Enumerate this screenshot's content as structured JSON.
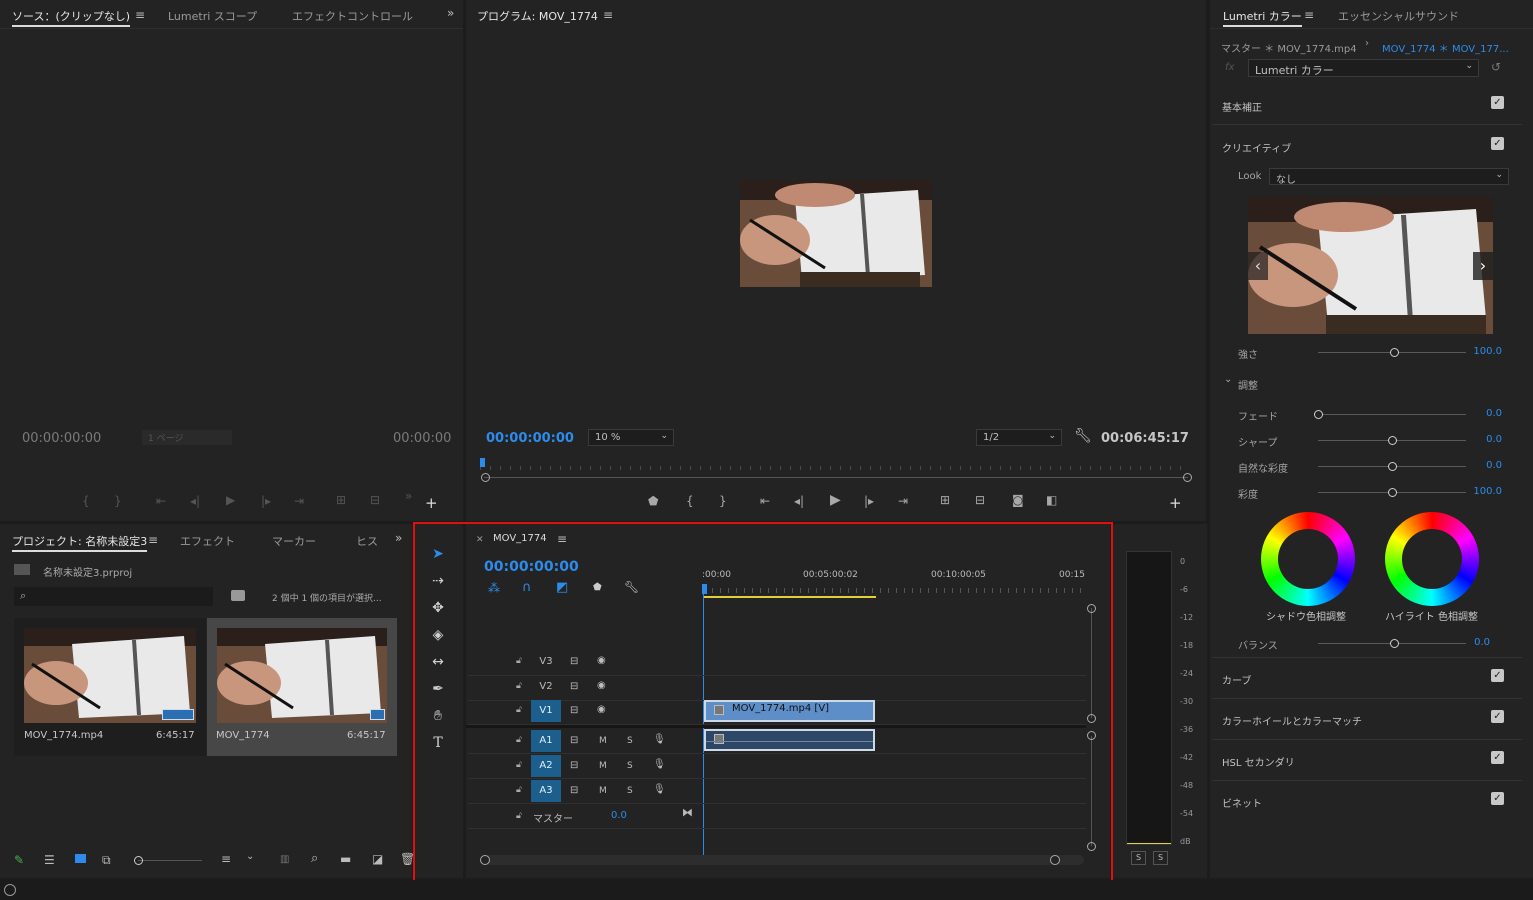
{
  "source_panel": {
    "tabs": [
      "ソース：(クリップなし)",
      "Lumetri スコープ",
      "エフェクトコントロール"
    ],
    "timecode_left": "00:00:00:00",
    "timecode_right": "00:00:00",
    "page_field": "1 ページ"
  },
  "program_panel": {
    "title": "プログラム: MOV_1774",
    "timecode": "00:00:00:00",
    "zoom": "10 %",
    "resolution": "1/2",
    "duration": "00:06:45:17"
  },
  "lumetri_panel": {
    "tabs": [
      "Lumetri カラー",
      "エッセンシャルサウンド"
    ],
    "master_label": "マスター ＊ MOV_1774.mp4",
    "clip_label": "MOV_1774 ＊ MOV_177...",
    "effect_dropdown": "Lumetri カラー",
    "sections": {
      "basic": "基本補正",
      "creative": "クリエイティブ",
      "curves": "カーブ",
      "color_wheels": "カラーホイールとカラーマッチ",
      "hsl": "HSL セカンダリ",
      "vignette": "ビネット"
    },
    "look_label": "Look",
    "look_value": "なし",
    "intensity_label": "強さ",
    "intensity_value": "100.0",
    "adjust_label": "調整",
    "sliders": [
      {
        "label": "フェード",
        "value": "0.0",
        "pos": 0.0
      },
      {
        "label": "シャープ",
        "value": "0.0",
        "pos": 0.5
      },
      {
        "label": "自然な彩度",
        "value": "0.0",
        "pos": 0.5
      },
      {
        "label": "彩度",
        "value": "100.0",
        "pos": 0.5
      }
    ],
    "intensity_pos": 0.5,
    "wheel_shadow_label": "シャドウ色相調整",
    "wheel_highlight_label": "ハイライト 色相調整",
    "balance_label": "バランス",
    "balance_value": "0.0",
    "balance_pos": 0.5
  },
  "project_panel": {
    "tabs": [
      "プロジェクト: 名称未設定3",
      "エフェクト",
      "マーカー",
      "ヒス"
    ],
    "file": "名称未設定3.prproj",
    "selection_info": "2 個中 1 個の項目が選択...",
    "search_placeholder": "",
    "items": [
      {
        "name": "MOV_1774.mp4",
        "duration": "6:45:17"
      },
      {
        "name": "MOV_1774",
        "duration": "6:45:17"
      }
    ]
  },
  "timeline": {
    "tab": "MOV_1774",
    "timecode": "00:00:00:00",
    "ruler": [
      ":00:00",
      "00:05:00:02",
      "00:10:00:05",
      "00:15"
    ],
    "video_tracks": [
      "V3",
      "V2",
      "V1"
    ],
    "audio_tracks": [
      "A1",
      "A2",
      "A3"
    ],
    "master_label": "マスター",
    "master_value": "0.0",
    "clip_video": "MOV_1774.mp4 [V]",
    "mute": "M",
    "solo": "S"
  },
  "meter": {
    "scale": [
      "0",
      "-6",
      "-12",
      "-18",
      "-24",
      "-30",
      "-36",
      "-42",
      "-48",
      "-54",
      "dB"
    ],
    "solo_left": "S",
    "solo_right": "S"
  },
  "colors": {
    "accent": "#2d8ceb",
    "track_active": "#1d5f8c",
    "clip_video": "#5d8ec8",
    "highlight_box": "#e01010"
  }
}
